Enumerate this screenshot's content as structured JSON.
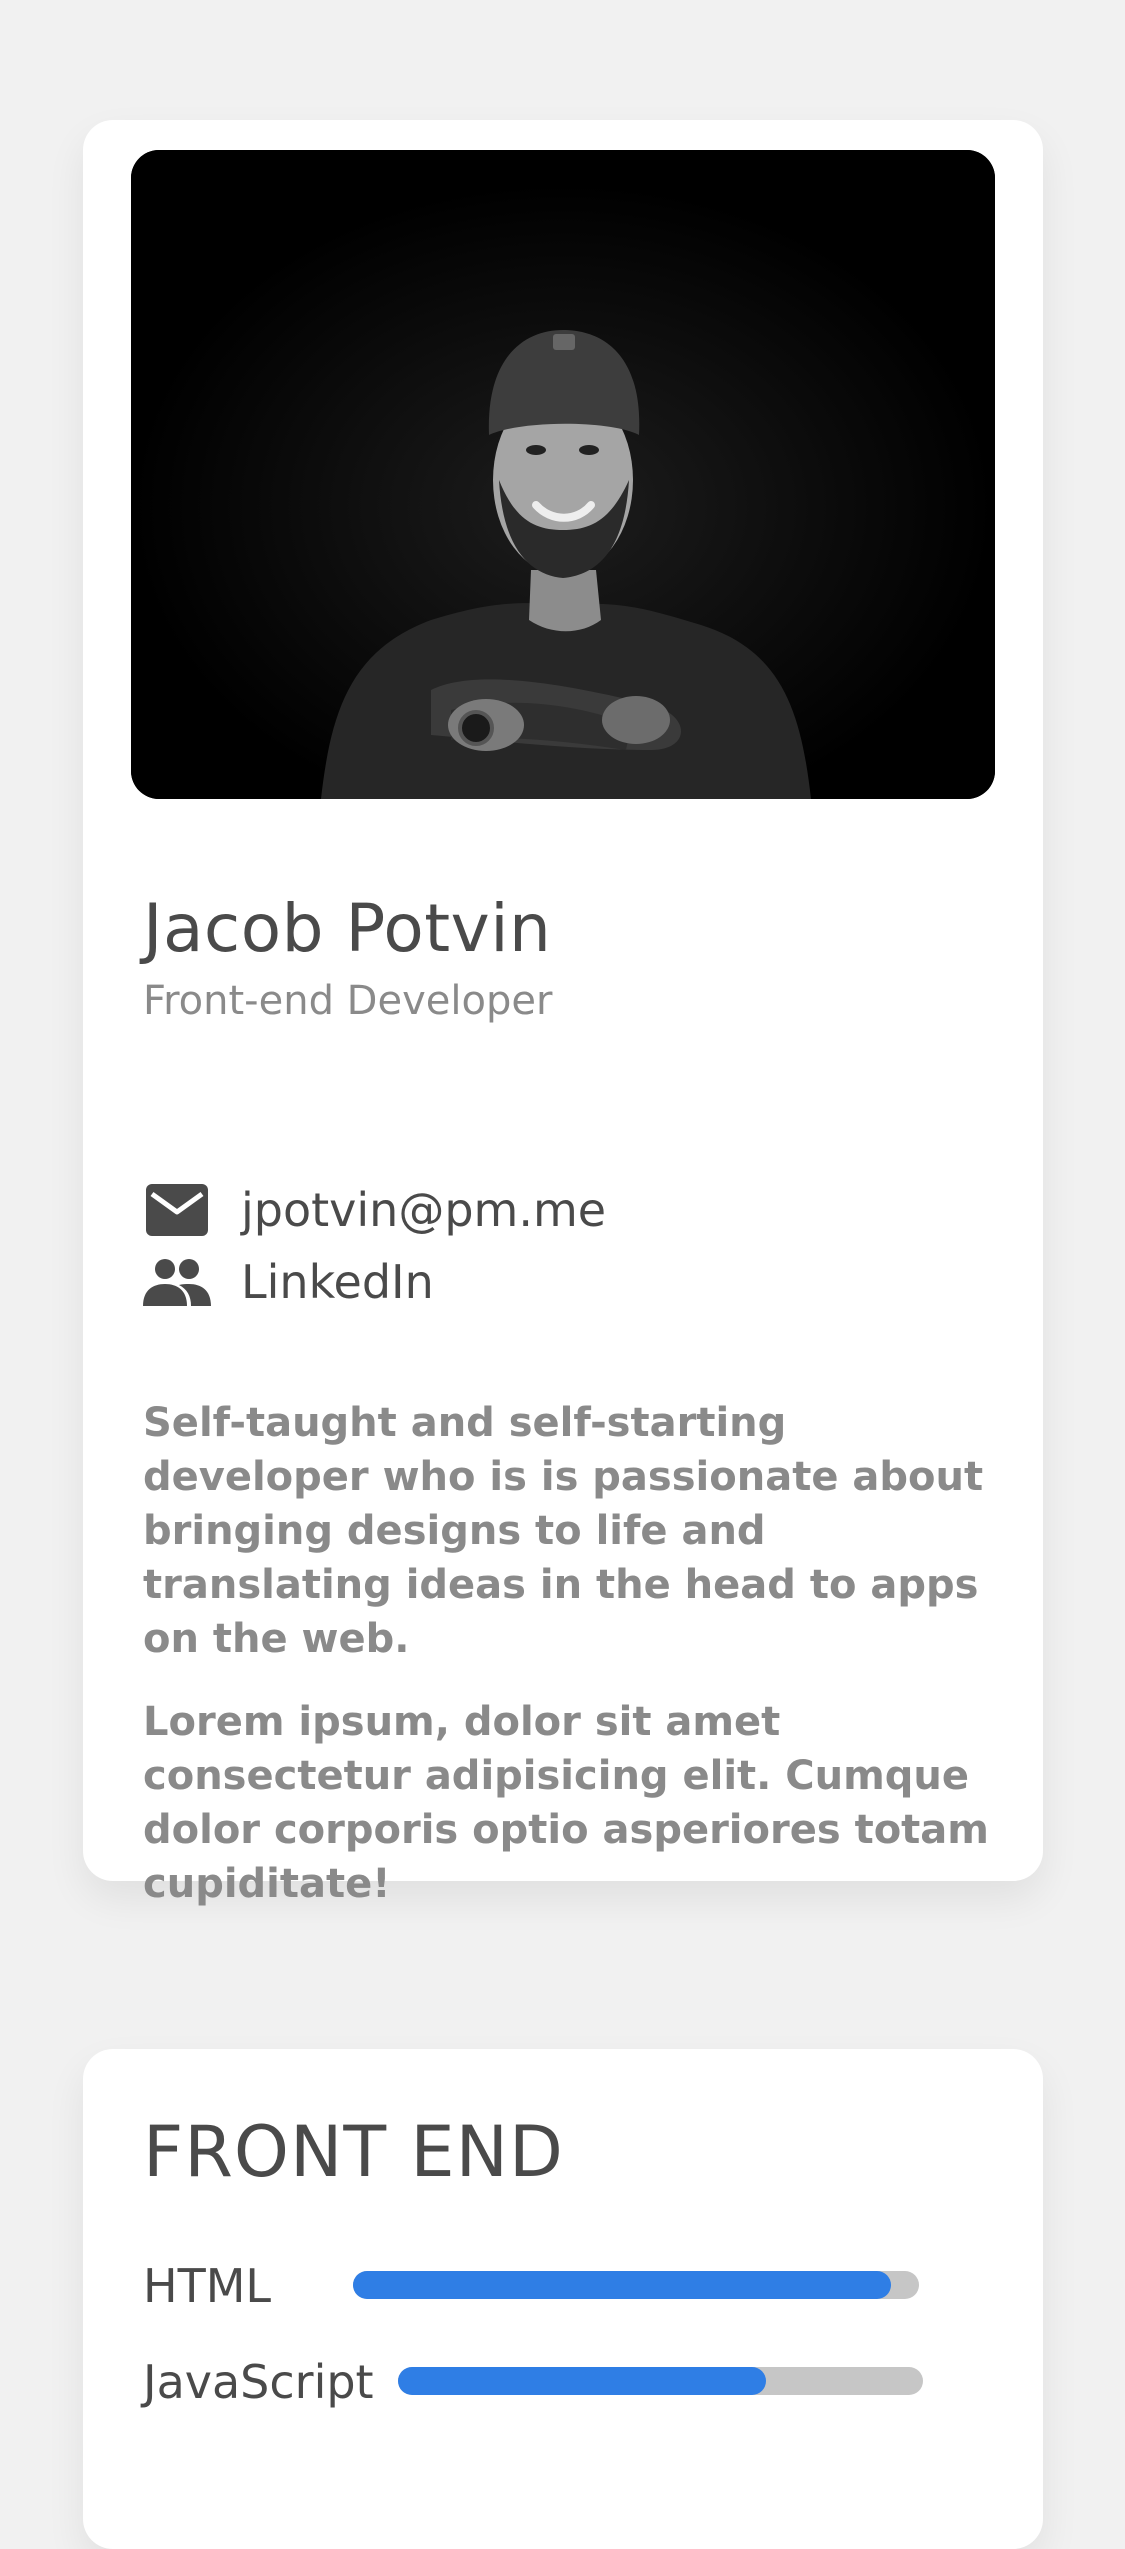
{
  "profile": {
    "name": "Jacob Potvin",
    "role": "Front-end Developer",
    "email": "jpotvin@pm.me",
    "linkedin": "LinkedIn",
    "bio": [
      "Self-taught and self-starting developer who is is passionate about bringing designs to life and translating ideas in the head to apps on the web.",
      "Lorem ipsum, dolor sit amet consectetur adipisicing elit. Cumque dolor corporis optio asperiores totam cupiditate!"
    ]
  },
  "icons": {
    "email": "mail-icon",
    "linkedin": "people-icon"
  },
  "skills": {
    "title": "FRONT END",
    "items": [
      {
        "label": "HTML",
        "level": 0.95
      },
      {
        "label": "JavaScript",
        "level": 0.7
      }
    ]
  },
  "colors": {
    "background": "#f1f1f1",
    "card": "#ffffff",
    "text_dark": "#4a4a4a",
    "text_muted": "#8a8a8a",
    "bar_fill": "#2f7ee5",
    "bar_track": "#c6c6c6"
  }
}
